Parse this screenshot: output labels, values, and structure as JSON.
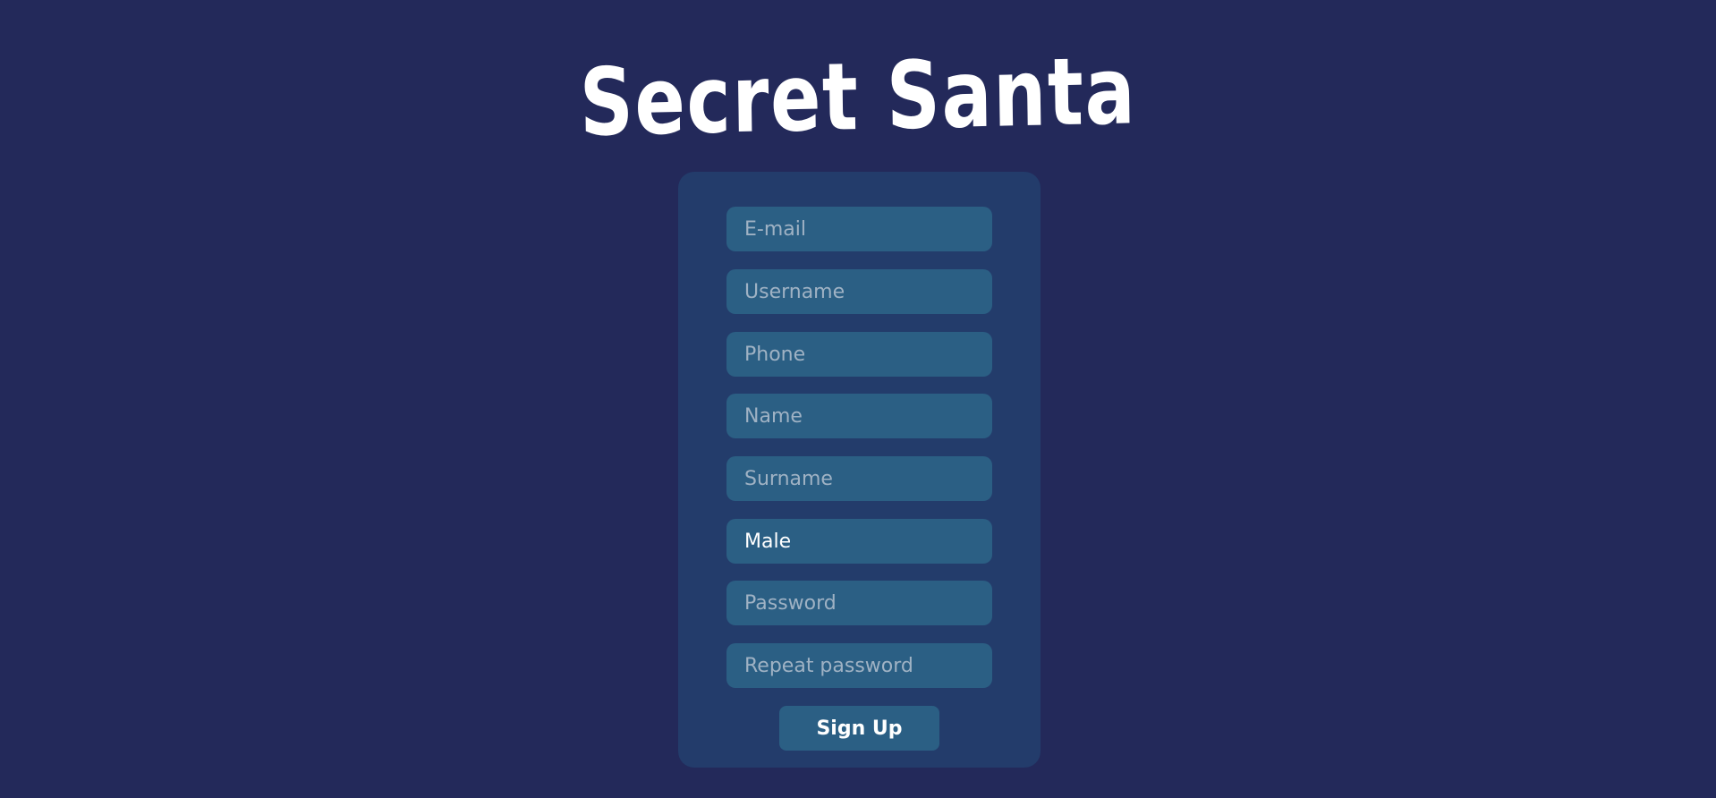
{
  "app": {
    "title": "Secret Santa"
  },
  "form": {
    "email_placeholder": "E-mail",
    "username_placeholder": "Username",
    "phone_placeholder": "Phone",
    "name_placeholder": "Name",
    "surname_placeholder": "Surname",
    "gender_value": "Male",
    "password_placeholder": "Password",
    "repeat_password_placeholder": "Repeat password",
    "submit_label": "Sign Up"
  },
  "colors": {
    "background": "#23295a",
    "card": "#233c6b",
    "field": "#2b5f84",
    "text": "#ffffff",
    "placeholder": "#9fb2c4"
  }
}
